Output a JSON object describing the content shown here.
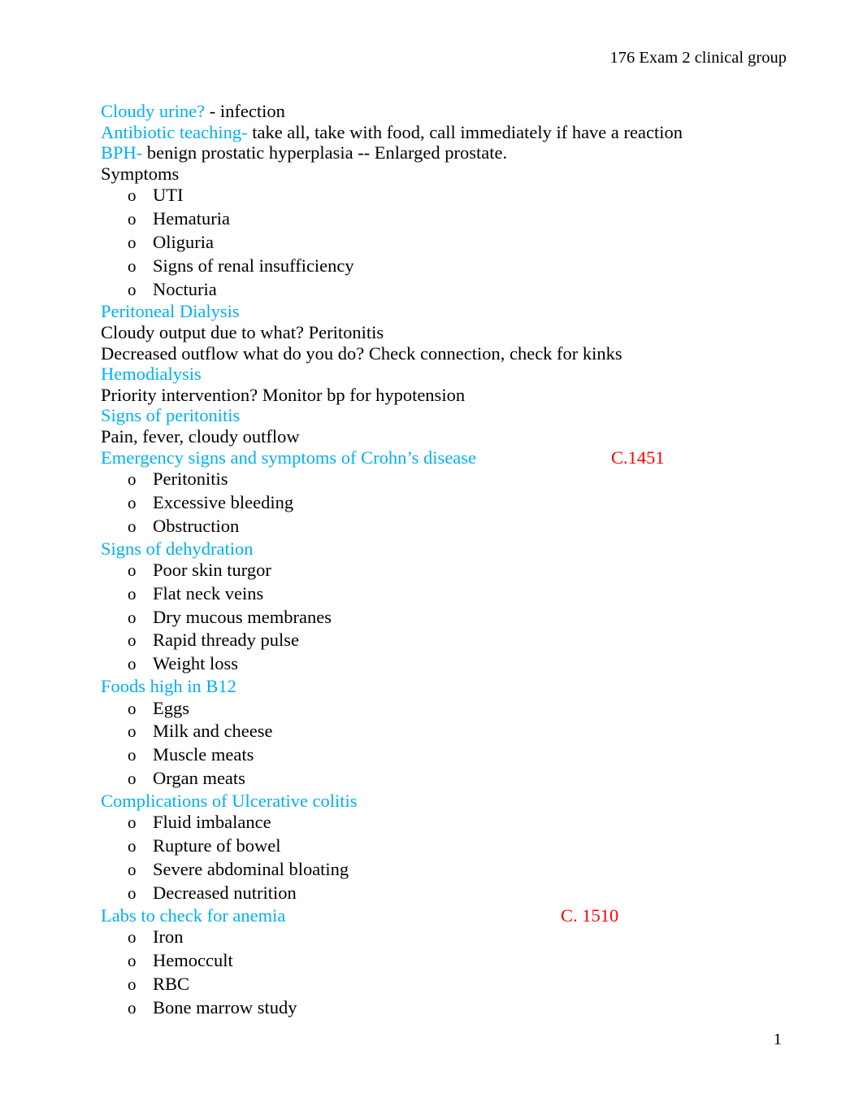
{
  "document": {
    "header": "176 Exam 2 clinical group",
    "page_number": "1",
    "colors": {
      "heading": "#00B0F0",
      "page_reference": "#FF0000",
      "body_text": "#000000"
    },
    "bullet_marker": "o"
  },
  "blocks": [
    {
      "id": "cloudy-urine",
      "lead": "Cloudy urine?",
      "rest": "  - infection"
    },
    {
      "id": "antibiotic-teaching",
      "lead": "Antibiotic teaching-",
      "rest": "  take all, take with food, call immediately if have a reaction"
    },
    {
      "id": "bph",
      "lead": "BPH-",
      "rest": " benign prostatic hyperplasia -- Enlarged prostate."
    },
    {
      "id": "symptoms",
      "plain": "Symptoms",
      "items": [
        "UTI",
        "Hematuria",
        "Oliguria",
        "Signs of renal insufficiency",
        "Nocturia"
      ]
    },
    {
      "id": "peritoneal-dialysis",
      "heading": "Peritoneal Dialysis",
      "lines": [
        "Cloudy output due to what? Peritonitis",
        "Decreased outflow what do you do? Check connection, check for kinks"
      ]
    },
    {
      "id": "hemodialysis",
      "heading": "Hemodialysis",
      "lines": [
        "Priority intervention? Monitor bp for hypotension"
      ]
    },
    {
      "id": "signs-of-peritonitis",
      "heading": "Signs of peritonitis",
      "lines": [
        "Pain, fever, cloudy outflow"
      ]
    },
    {
      "id": "crohns-emergency",
      "heading": "Emergency signs and symptoms of Crohn’s disease",
      "reference": "C.1451",
      "items": [
        "Peritonitis",
        "Excessive bleeding",
        "Obstruction"
      ]
    },
    {
      "id": "signs-of-dehydration",
      "heading": "Signs of dehydration",
      "items": [
        "Poor skin turgor",
        "Flat neck veins",
        "Dry mucous membranes",
        "Rapid thready pulse",
        "Weight loss"
      ]
    },
    {
      "id": "foods-high-in-b12",
      "heading": "Foods high in B12",
      "items": [
        "Eggs",
        "Milk and cheese",
        "Muscle meats",
        "Organ meats"
      ]
    },
    {
      "id": "ulcerative-colitis-complications",
      "heading": "Complications of Ulcerative colitis",
      "items": [
        "Fluid imbalance",
        "Rupture of bowel",
        "Severe abdominal bloating",
        "Decreased nutrition"
      ]
    },
    {
      "id": "labs-for-anemia",
      "heading": "Labs to check for anemia",
      "reference": "C. 1510",
      "items": [
        "Iron",
        "Hemoccult",
        "RBC",
        "Bone marrow study"
      ]
    }
  ]
}
